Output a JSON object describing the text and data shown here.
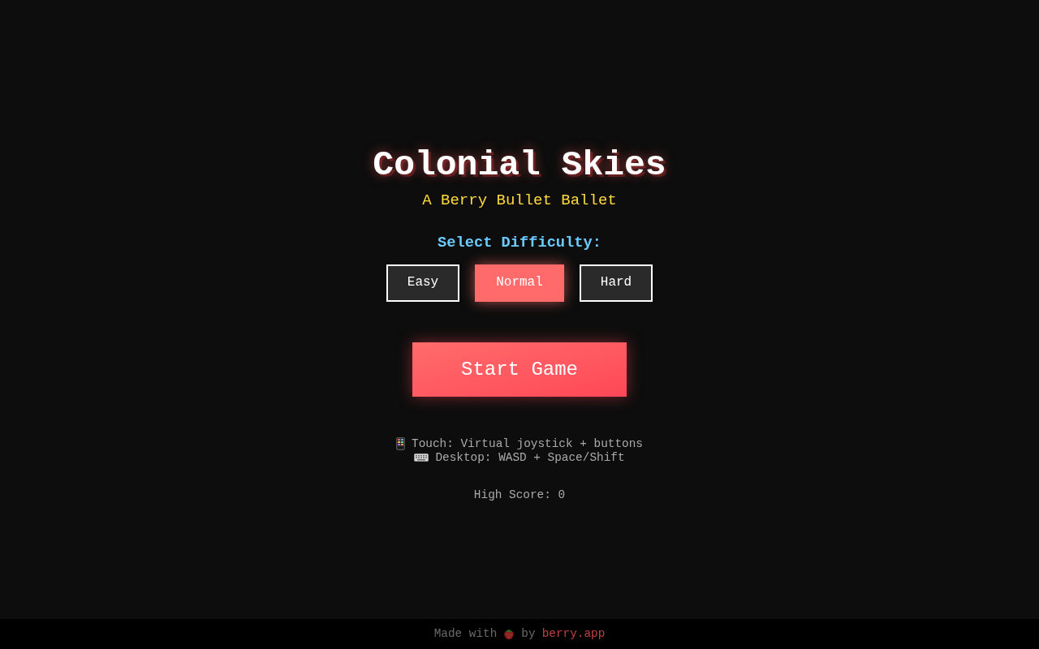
{
  "title": "Colonial Skies",
  "subtitle": "A Berry Bullet Ballet",
  "difficulty": {
    "label": "Select Difficulty:",
    "options": [
      {
        "label": "Easy",
        "selected": false
      },
      {
        "label": "Normal",
        "selected": true
      },
      {
        "label": "Hard",
        "selected": false
      }
    ]
  },
  "start_button": "Start Game",
  "controls": [
    {
      "kind": "touch",
      "text": "Touch: Virtual joystick + buttons"
    },
    {
      "kind": "desktop",
      "text": "Desktop: WASD + Space/Shift"
    }
  ],
  "high_score": "High Score: 0",
  "footer": {
    "text_before": "Made with",
    "text_after": "by",
    "link": "berry.app"
  }
}
